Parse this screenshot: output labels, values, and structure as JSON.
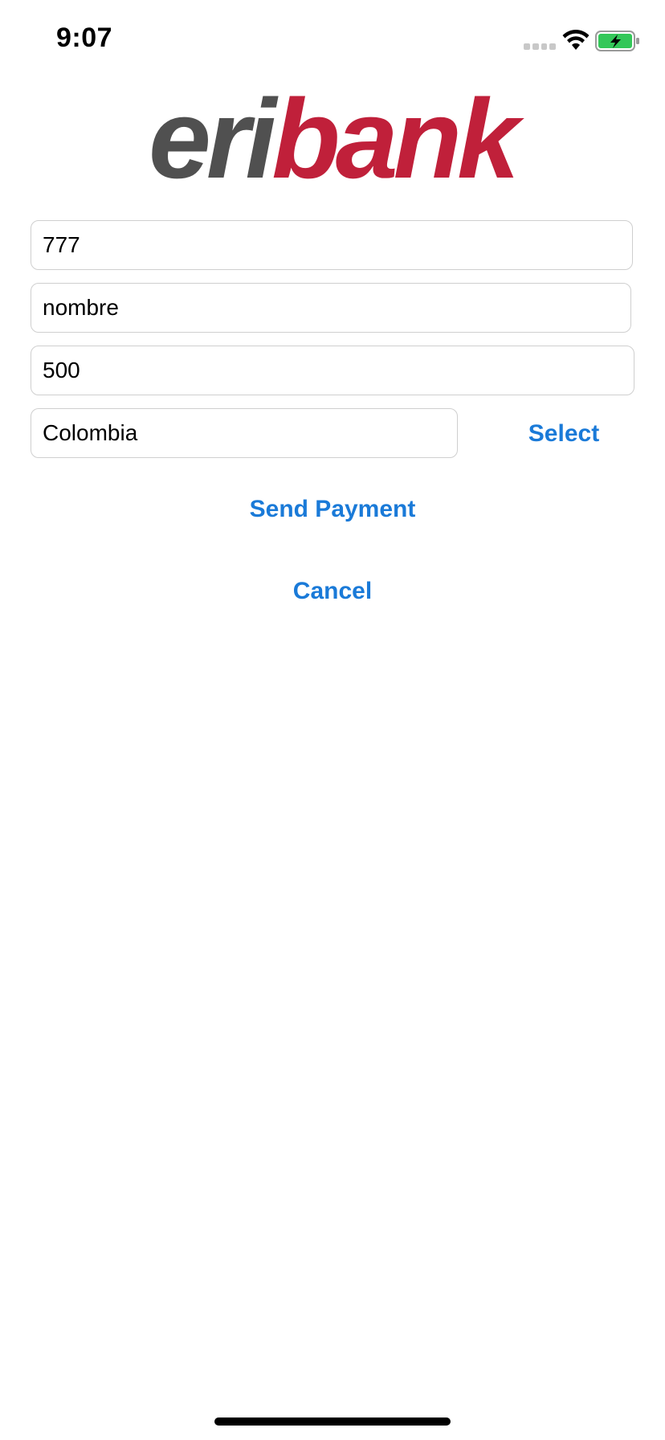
{
  "status_bar": {
    "time": "9:07",
    "icons": [
      "signal-icon",
      "wifi-icon",
      "battery-charging-icon"
    ],
    "battery_color": "#34c759"
  },
  "logo": {
    "part1": "eri",
    "part2": "bank",
    "colors": {
      "part1": "#505050",
      "part2": "#c0203a"
    }
  },
  "form": {
    "account_value": "777",
    "name_value": "nombre",
    "amount_value": "500",
    "country_value": "Colombia",
    "select_label": "Select"
  },
  "actions": {
    "send_label": "Send Payment",
    "cancel_label": "Cancel"
  },
  "accent_color": "#1a7ad8"
}
